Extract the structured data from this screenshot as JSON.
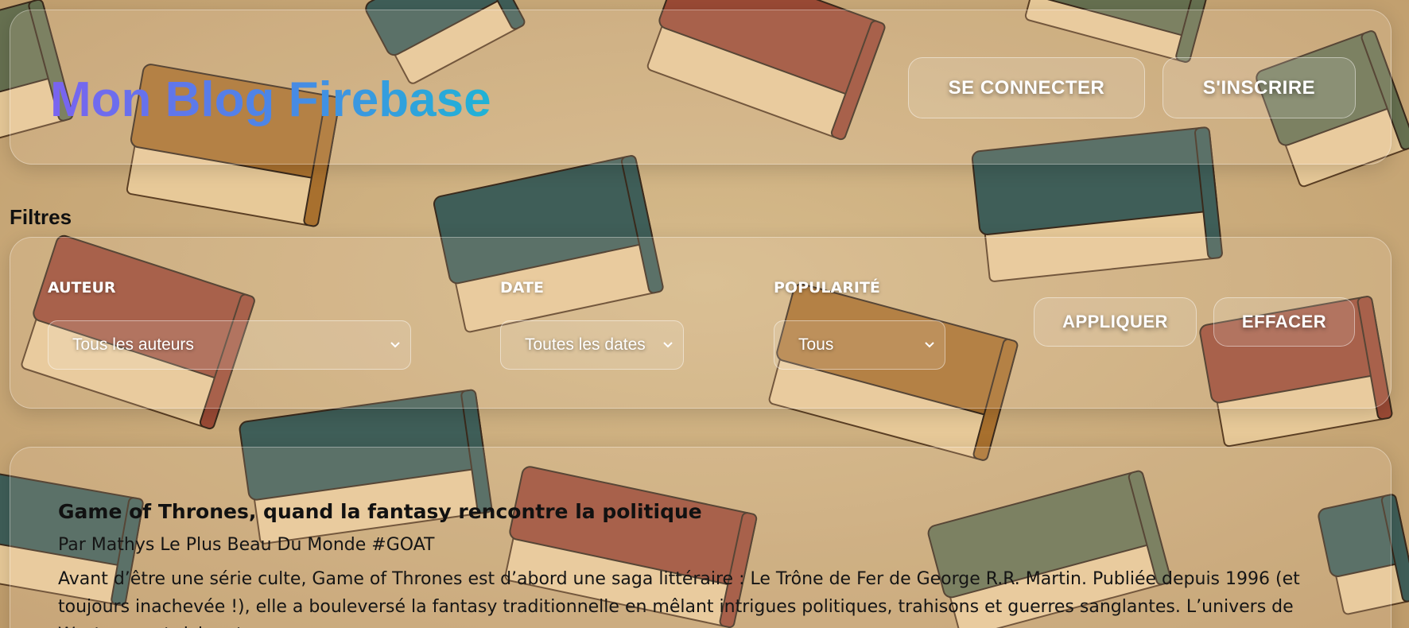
{
  "header": {
    "brand": "Mon Blog Firebase",
    "login_label": "SE CONNECTER",
    "signup_label": "S'INSCRIRE"
  },
  "filters": {
    "heading": "Filtres",
    "author": {
      "label": "AUTEUR",
      "selected": "Tous les auteurs"
    },
    "date": {
      "label": "DATE",
      "selected": "Toutes les dates"
    },
    "popularity": {
      "label": "POPULARITÉ",
      "selected": "Tous"
    },
    "apply_label": "APPLIQUER",
    "clear_label": "EFFACER"
  },
  "posts": [
    {
      "title": "Game of Thrones, quand la fantasy rencontre la politique",
      "byline": "Par Mathys Le Plus Beau Du Monde #GOAT",
      "excerpt": "Avant d’être une série culte, Game of Thrones est d’abord une saga littéraire : Le Trône de Fer de George R.R. Martin. Publiée depuis 1996 (et toujours inachevée !), elle a bouleversé la fantasy traditionnelle en mêlant intrigues politiques, trahisons et guerres sanglantes. L’univers de Westeros est riche et"
    }
  ],
  "colors": {
    "parchment": "#c9a97a",
    "book_red": "#9a4a35",
    "book_green": "#3f5e58",
    "book_brown": "#a8702e",
    "book_olive": "#667050",
    "brand_gradient_start": "#7a63f0",
    "brand_gradient_end": "#1fb3d6"
  }
}
